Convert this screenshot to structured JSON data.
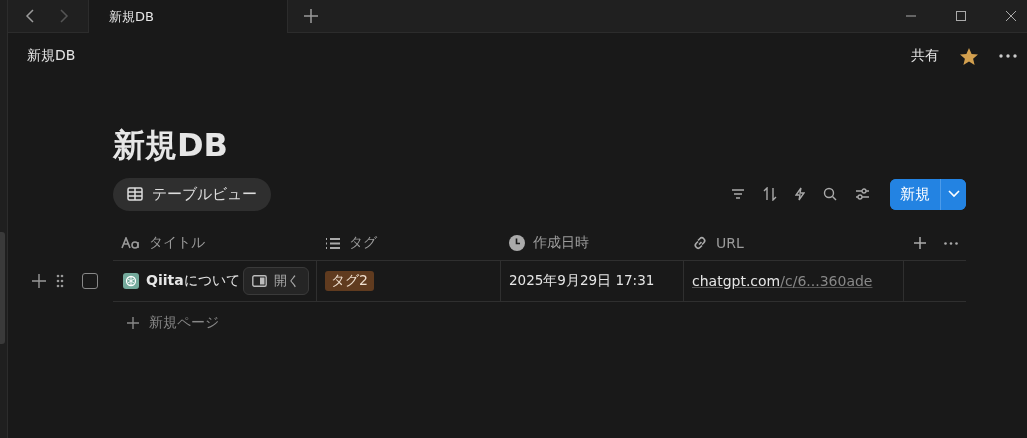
{
  "tab": {
    "label": "新規DB",
    "selected": true
  },
  "breadcrumb": "新規DB",
  "share": "共有",
  "favorite": true,
  "title": "新規DB",
  "view": {
    "label": "テーブルビュー"
  },
  "new_button": "新規",
  "columns": [
    {
      "label": "タイトル",
      "kind": "title"
    },
    {
      "label": "タグ",
      "kind": "select"
    },
    {
      "label": "作成日時",
      "kind": "date"
    },
    {
      "label": "URL",
      "kind": "url"
    }
  ],
  "rows": [
    {
      "checked": false,
      "title": "**Qiita**について",
      "open": "開く",
      "tag": "タグ2",
      "created": "2025年9月29日 17:31",
      "url_host": "chatgpt.com",
      "url_path": "/c/6...360ade"
    }
  ],
  "new_page": "新規ページ"
}
